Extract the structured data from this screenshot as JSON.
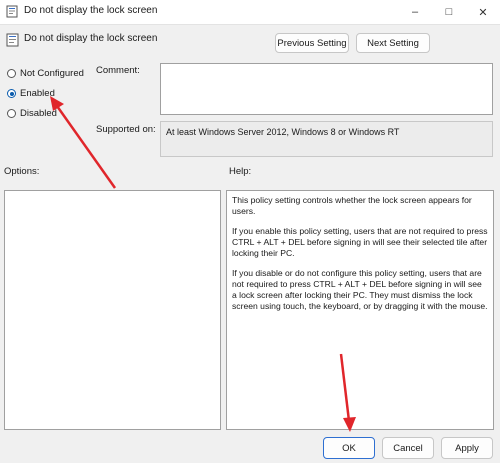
{
  "window": {
    "title": "Do not display the lock screen",
    "minimize_glyph": "–",
    "maximize_glyph": "□",
    "close_glyph": "✕"
  },
  "header": {
    "policy_name": "Do not display the lock screen",
    "previous_label": "Previous Setting",
    "next_label": "Next Setting"
  },
  "state": {
    "options": [
      {
        "label": "Not Configured",
        "selected": false
      },
      {
        "label": "Enabled",
        "selected": true
      },
      {
        "label": "Disabled",
        "selected": false
      }
    ]
  },
  "comment": {
    "label": "Comment:",
    "value": ""
  },
  "supported": {
    "label": "Supported on:",
    "value": "At least Windows Server 2012, Windows 8 or Windows RT"
  },
  "options_panel": {
    "label": "Options:"
  },
  "help": {
    "label": "Help:",
    "paragraphs": [
      "This policy setting controls whether the lock screen appears for users.",
      "If you enable this policy setting, users that are not required to press CTRL + ALT + DEL before signing in will see their selected tile after locking their PC.",
      "If you disable or do not configure this policy setting, users that are not required to press CTRL + ALT + DEL before signing in will see a lock screen after locking their PC. They must dismiss the lock screen using touch, the keyboard, or by dragging it with the mouse."
    ]
  },
  "footer": {
    "ok_label": "OK",
    "cancel_label": "Cancel",
    "apply_label": "Apply"
  },
  "colors": {
    "annotation_arrow": "#e0262b",
    "radio_selected": "#0b5cad"
  },
  "icons": {
    "title": "policy-icon",
    "header": "policy-icon"
  }
}
